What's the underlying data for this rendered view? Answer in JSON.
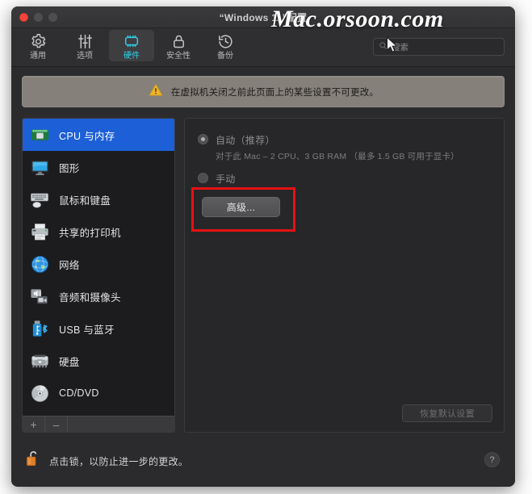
{
  "window": {
    "title": "“Windows 11”配置",
    "traffic_lights": [
      "close",
      "minimize",
      "maximize"
    ]
  },
  "watermark": {
    "text": "Mac.orsoon.com"
  },
  "toolbar": {
    "items": [
      {
        "label": "通用",
        "icon": "gear-icon",
        "selected": false
      },
      {
        "label": "选项",
        "icon": "sliders-icon",
        "selected": false
      },
      {
        "label": "硬件",
        "icon": "chip-icon",
        "selected": true
      },
      {
        "label": "安全性",
        "icon": "lock-icon",
        "selected": false
      },
      {
        "label": "备份",
        "icon": "clock-back-icon",
        "selected": false
      }
    ],
    "search": {
      "placeholder": "搜索",
      "value": "",
      "icon": "search-icon"
    }
  },
  "warning": {
    "icon": "warning-triangle-icon",
    "text": "在虚拟机关闭之前此页面上的某些设置不可更改。"
  },
  "sidebar": {
    "items": [
      {
        "label": "CPU 与内存",
        "icon": "memory-chip-icon",
        "selected": true
      },
      {
        "label": "图形",
        "icon": "display-icon",
        "selected": false
      },
      {
        "label": "鼠标和键盘",
        "icon": "keyboard-mouse-icon",
        "selected": false
      },
      {
        "label": "共享的打印机",
        "icon": "printer-icon",
        "selected": false
      },
      {
        "label": "网络",
        "icon": "globe-icon",
        "selected": false
      },
      {
        "label": "音频和摄像头",
        "icon": "audio-camera-icon",
        "selected": false
      },
      {
        "label": "USB 与蓝牙",
        "icon": "usb-bluetooth-icon",
        "selected": false
      },
      {
        "label": "硬盘",
        "icon": "harddisk-icon",
        "selected": false
      },
      {
        "label": "CD/DVD",
        "icon": "cd-dvd-icon",
        "selected": false
      }
    ],
    "add_label": "+",
    "remove_label": "–"
  },
  "main": {
    "auto_option": {
      "label": "自动（推荐）",
      "selected": true,
      "disabled": true
    },
    "auto_note": "对于此 Mac – 2 CPU、3 GB RAM （最多 1.5 GB 可用于显卡）",
    "manual_option": {
      "label": "手动",
      "selected": false,
      "disabled": true
    },
    "advanced_button": "高级...",
    "restore_button": "恢复默认设置"
  },
  "footer": {
    "lock_icon": "open-lock-icon",
    "text": "点击锁，以防止进一步的更改。",
    "help_label": "?"
  },
  "colors": {
    "accent_selected": "#1d5fd6",
    "toolbar_active": "#2fd0e8",
    "warning_bg": "#85807a",
    "highlight_box": "#e61212",
    "window_bg": "#2b2b2d"
  }
}
